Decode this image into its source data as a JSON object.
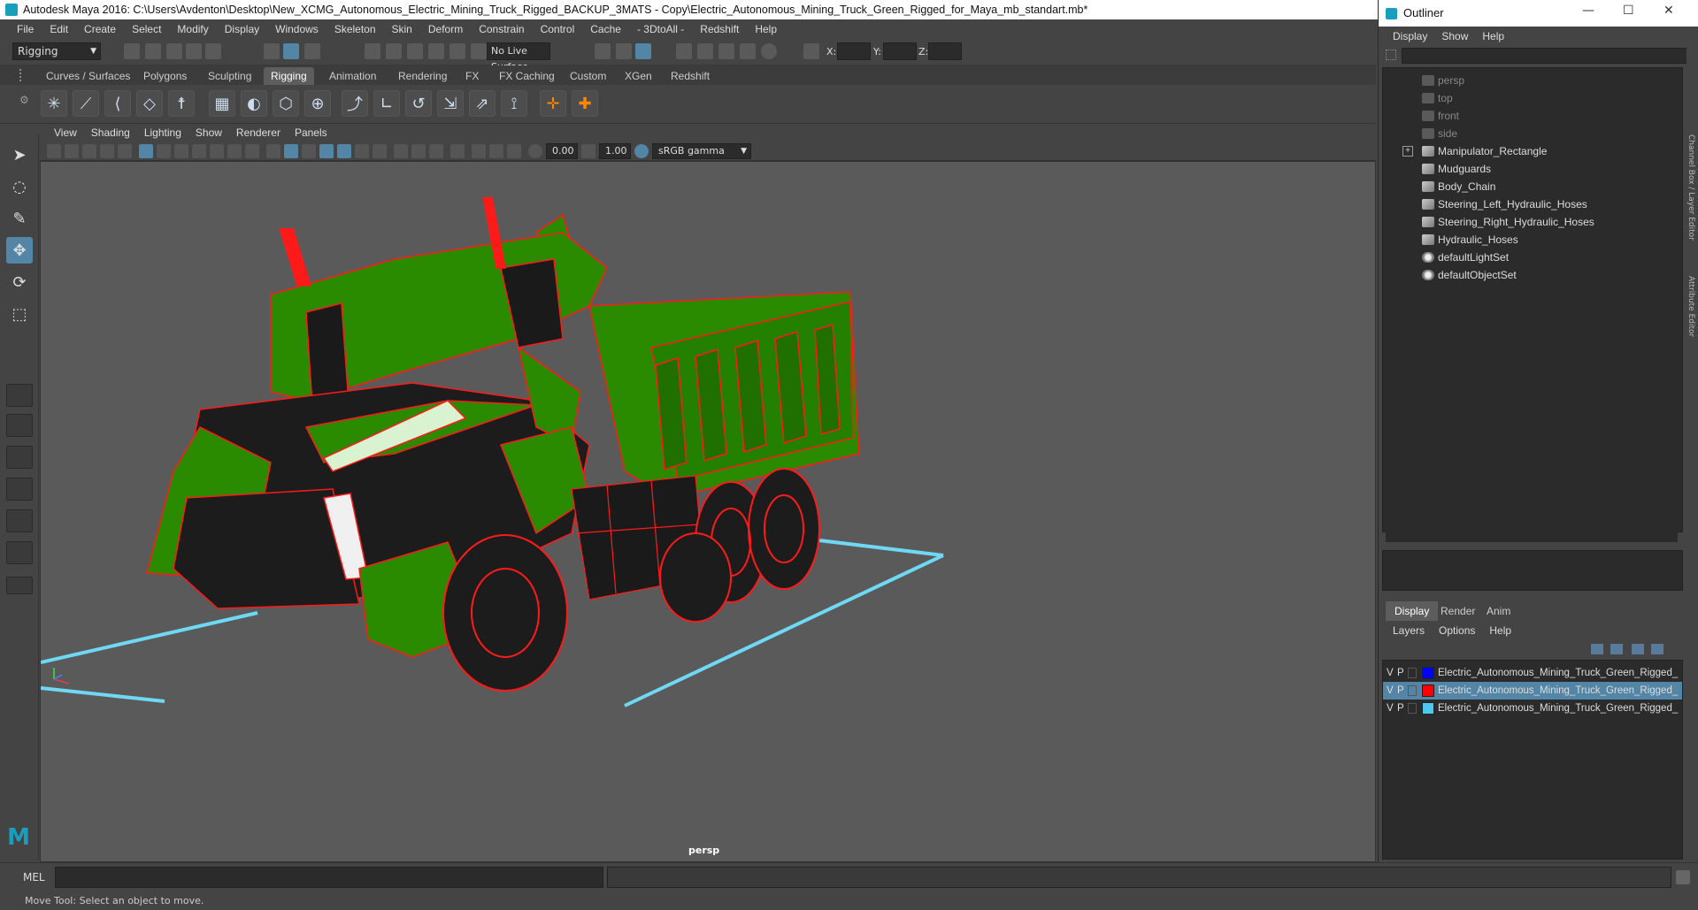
{
  "window": {
    "title": "Autodesk Maya 2016: C:\\Users\\Avdenton\\Desktop\\New_XCMG_Autonomous_Electric_Mining_Truck_Rigged_BACKUP_3MATS - Copy\\Electric_Autonomous_Mining_Truck_Green_Rigged_for_Maya_mb_standart.mb*"
  },
  "menubar": [
    "File",
    "Edit",
    "Create",
    "Select",
    "Modify",
    "Display",
    "Windows",
    "Skeleton",
    "Skin",
    "Deform",
    "Constrain",
    "Control",
    "Cache",
    "- 3DtoAll -",
    "Redshift",
    "Help"
  ],
  "statusline": {
    "mode": "Rigging",
    "live_surface": "No Live Surface",
    "x_label": "X:",
    "y_label": "Y:",
    "z_label": "Z:"
  },
  "shelf_tabs": [
    "Curves / Surfaces",
    "Polygons",
    "Sculpting",
    "Rigging",
    "Animation",
    "Rendering",
    "FX",
    "FX Caching",
    "Custom",
    "XGen",
    "Redshift"
  ],
  "shelf_active": "Rigging",
  "viewport": {
    "menu": [
      "View",
      "Shading",
      "Lighting",
      "Show",
      "Renderer",
      "Panels"
    ],
    "field_a": "0.00",
    "field_b": "1.00",
    "color_space": "sRGB gamma",
    "camera": "persp"
  },
  "cmdline": {
    "label": "MEL"
  },
  "helpline": "Move Tool: Select an object to move.",
  "outliner": {
    "title": "Outliner",
    "menu": [
      "Display",
      "Show",
      "Help"
    ],
    "items": [
      {
        "label": "persp",
        "icon": "camera-icon",
        "dim": true,
        "expand": false
      },
      {
        "label": "top",
        "icon": "camera-icon",
        "dim": true,
        "expand": false
      },
      {
        "label": "front",
        "icon": "camera-icon",
        "dim": true,
        "expand": false
      },
      {
        "label": "side",
        "icon": "camera-icon",
        "dim": true,
        "expand": false
      },
      {
        "label": "Manipulator_Rectangle",
        "icon": "transform-icon",
        "dim": false,
        "expand": true
      },
      {
        "label": "Mudguards",
        "icon": "transform-icon",
        "dim": false,
        "expand": false
      },
      {
        "label": "Body_Chain",
        "icon": "transform-icon",
        "dim": false,
        "expand": false
      },
      {
        "label": "Steering_Left_Hydraulic_Hoses",
        "icon": "transform-icon",
        "dim": false,
        "expand": false
      },
      {
        "label": "Steering_Right_Hydraulic_Hoses",
        "icon": "transform-icon",
        "dim": false,
        "expand": false
      },
      {
        "label": "Hydraulic_Hoses",
        "icon": "transform-icon",
        "dim": false,
        "expand": false
      },
      {
        "label": "defaultLightSet",
        "icon": "set-icon",
        "dim": false,
        "expand": false
      },
      {
        "label": "defaultObjectSet",
        "icon": "set-icon",
        "dim": false,
        "expand": false
      }
    ]
  },
  "layer_editor": {
    "tabs": [
      "Display",
      "Render",
      "Anim"
    ],
    "active_tab": "Display",
    "menu": [
      "Layers",
      "Options",
      "Help"
    ],
    "layers": [
      {
        "v": "V",
        "p": "P",
        "color": "#0000ff",
        "name": "Electric_Autonomous_Mining_Truck_Green_Rigged_",
        "selected": false
      },
      {
        "v": "V",
        "p": "P",
        "color": "#ff0000",
        "name": "Electric_Autonomous_Mining_Truck_Green_Rigged_",
        "selected": true
      },
      {
        "v": "V",
        "p": "P",
        "color": "#4fc8f0",
        "name": "Electric_Autonomous_Mining_Truck_Green_Rigged_",
        "selected": false
      }
    ]
  },
  "right_strip": {
    "label_a": "Channel Box / Layer Editor",
    "label_b": "Attribute Editor"
  }
}
